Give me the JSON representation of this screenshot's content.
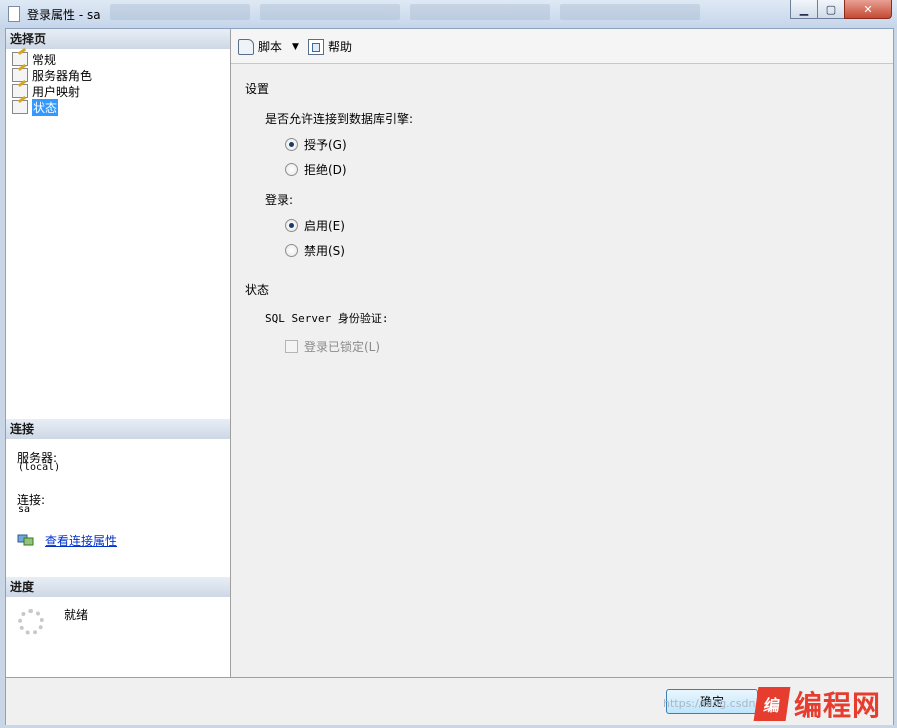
{
  "window": {
    "title": "登录属性 - sa",
    "min_label": "▁",
    "max_label": "▢",
    "close_label": "✕"
  },
  "left": {
    "select_page_header": "选择页",
    "pages": [
      {
        "label": "常规"
      },
      {
        "label": "服务器角色"
      },
      {
        "label": "用户映射"
      },
      {
        "label": "状态"
      }
    ],
    "selected_page": "状态",
    "connection_header": "连接",
    "server_label": "服务器:",
    "server_value": "(local)",
    "connection_label": "连接:",
    "connection_value": "sa",
    "view_props_link": "查看连接属性",
    "progress_header": "进度",
    "progress_status": "就绪"
  },
  "toolbar": {
    "script_label": "脚本",
    "script_dropdown": "▼",
    "help_label": "帮助"
  },
  "settings": {
    "section_title": "设置",
    "permission_label": "是否允许连接到数据库引擎:",
    "grant_label": "授予(G)",
    "deny_label": "拒绝(D)",
    "login_label": "登录:",
    "enable_label": "启用(E)",
    "disable_label": "禁用(S)"
  },
  "status": {
    "section_title": "状态",
    "sql_auth_label": "SQL Server 身份验证:",
    "locked_label": "登录已锁定(L)"
  },
  "buttons": {
    "ok_label": "确定"
  },
  "watermark": {
    "url_text": "https://blog.csdn",
    "logo_mark": "编",
    "logo_text": "编程网"
  }
}
